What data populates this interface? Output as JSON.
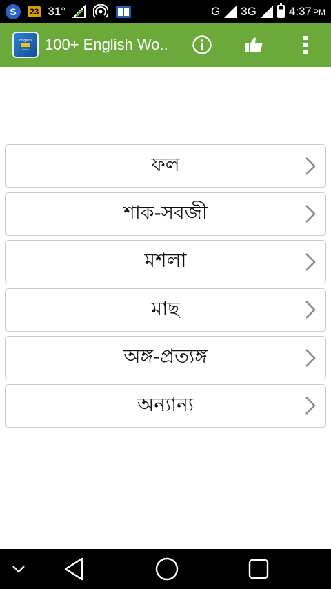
{
  "status_bar": {
    "notification_count": "23",
    "temperature": "31°",
    "network_letter": "G",
    "network_type": "3G",
    "time": "4:37",
    "ampm": "PM"
  },
  "app_bar": {
    "title": "100+ English Wo..",
    "logo_text": "English"
  },
  "list": {
    "items": [
      {
        "label": "ফল"
      },
      {
        "label": "শাক-সবজী"
      },
      {
        "label": "মশলা"
      },
      {
        "label": "মাছ"
      },
      {
        "label": "অঙ্গ-প্রত্যঙ্গ"
      },
      {
        "label": "অন্যান্য"
      }
    ]
  },
  "colors": {
    "app_bar": "#6aa93a",
    "status_bar": "#000000",
    "item_border": "#c9c9c9",
    "chevron": "#8a8a8a"
  }
}
